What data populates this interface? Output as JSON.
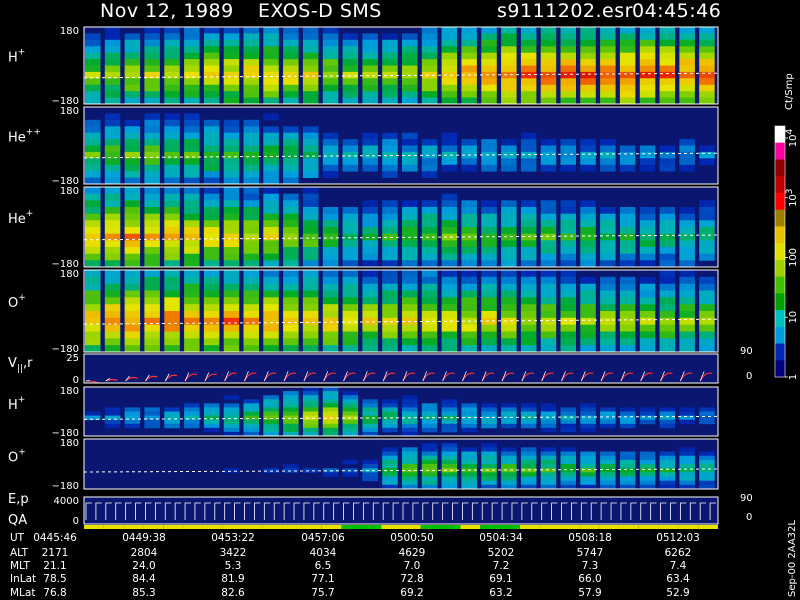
{
  "header": {
    "date": "Nov 12, 1989",
    "instrument": "EXOS-D SMS",
    "file": "s9111202.esr",
    "time": "04:45:46"
  },
  "chart_data": {
    "type": "heatmap",
    "panels": [
      {
        "label": "H",
        "sup": "+",
        "ymax": "180",
        "ymin": "−180",
        "intensity": [
          0.62,
          0.64,
          0.66,
          0.67,
          0.69,
          0.7,
          0.72,
          0.74,
          0.75,
          0.76,
          0.74,
          0.72,
          0.66,
          0.62,
          0.6,
          0.62,
          0.66,
          0.7,
          0.78,
          0.82,
          0.84,
          0.86,
          0.86,
          0.87,
          0.87,
          0.88,
          0.88,
          0.88,
          0.87,
          0.87,
          0.86,
          0.86
        ]
      },
      {
        "label": "He",
        "sup": "++",
        "ymax": "180",
        "ymin": "−180",
        "intensity": [
          0.55,
          0.58,
          0.58,
          0.57,
          0.56,
          0.55,
          0.55,
          0.54,
          0.53,
          0.52,
          0.5,
          0.45,
          0.4,
          0.38,
          0.36,
          0.36,
          0.35,
          0.35,
          0.34,
          0.33,
          0.33,
          0.32,
          0.32,
          0.31,
          0.3,
          0.3,
          0.3,
          0.29,
          0.28,
          0.28,
          0.27,
          0.26
        ]
      },
      {
        "label": "He",
        "sup": "+",
        "ymax": "180",
        "ymin": "−180",
        "intensity": [
          0.78,
          0.8,
          0.8,
          0.78,
          0.77,
          0.76,
          0.74,
          0.72,
          0.7,
          0.68,
          0.66,
          0.6,
          0.52,
          0.48,
          0.46,
          0.5,
          0.56,
          0.58,
          0.57,
          0.56,
          0.55,
          0.55,
          0.54,
          0.53,
          0.52,
          0.51,
          0.5,
          0.5,
          0.49,
          0.48,
          0.47,
          0.46
        ]
      },
      {
        "label": "O",
        "sup": "+",
        "ymax": "180",
        "ymin": "−180",
        "intensity": [
          0.8,
          0.82,
          0.84,
          0.84,
          0.84,
          0.83,
          0.82,
          0.82,
          0.81,
          0.8,
          0.78,
          0.76,
          0.74,
          0.72,
          0.7,
          0.7,
          0.72,
          0.72,
          0.7,
          0.7,
          0.69,
          0.68,
          0.67,
          0.66,
          0.65,
          0.64,
          0.64,
          0.63,
          0.62,
          0.62,
          0.61,
          0.6
        ]
      },
      {
        "label": "V",
        "sub": "||",
        "label2": ",r",
        "ymax": "25",
        "ymin": "0",
        "ymax_r": "90",
        "ymin_r": "0",
        "values": [
          2,
          4,
          6,
          7,
          8,
          9,
          9,
          10,
          10,
          10,
          10,
          10,
          10,
          10,
          10,
          10,
          10,
          10,
          10,
          10,
          10,
          10,
          10,
          10,
          10,
          10,
          10,
          10,
          10,
          10,
          10,
          10
        ]
      },
      {
        "label": "H",
        "sup": "+",
        "ymax": "180",
        "ymin": "−180",
        "intensity": [
          0.22,
          0.26,
          0.3,
          0.32,
          0.34,
          0.36,
          0.4,
          0.46,
          0.52,
          0.58,
          0.64,
          0.7,
          0.72,
          0.6,
          0.5,
          0.46,
          0.44,
          0.42,
          0.4,
          0.38,
          0.37,
          0.36,
          0.35,
          0.34,
          0.33,
          0.32,
          0.31,
          0.3,
          0.29,
          0.28,
          0.27,
          0.26
        ]
      },
      {
        "label": "O",
        "sup": "+",
        "ymax": "180",
        "ymin": "−180",
        "intensity": [
          0.05,
          0.05,
          0.05,
          0.05,
          0.05,
          0.05,
          0.06,
          0.08,
          0.1,
          0.12,
          0.14,
          0.16,
          0.18,
          0.22,
          0.3,
          0.5,
          0.56,
          0.58,
          0.57,
          0.56,
          0.55,
          0.54,
          0.53,
          0.52,
          0.51,
          0.5,
          0.49,
          0.48,
          0.47,
          0.46,
          0.45,
          0.44
        ]
      },
      {
        "label": "E,p",
        "label2": "QA",
        "ymax": "4000",
        "ymin": "0",
        "ymax_r": "90",
        "ymin_r": "0"
      }
    ],
    "colorbar": {
      "title": "Ct/Smp",
      "ticks": [
        {
          "label": "10",
          "sup": "4",
          "value": 4
        },
        {
          "label": "10",
          "sup": "3",
          "value": 3
        },
        {
          "label": "100",
          "value": 2
        },
        {
          "label": "10",
          "value": 1
        },
        {
          "label": "1",
          "value": 0
        }
      ],
      "colors": [
        "#000080",
        "#0028b4",
        "#009cdc",
        "#00c0c0",
        "#00a000",
        "#40c000",
        "#a0d000",
        "#e0e000",
        "#e8c000",
        "#a08000",
        "#ff0000",
        "#c00000",
        "#900000",
        "#ff00a0",
        "#ffffff"
      ]
    },
    "qa_bar": [
      "yellow",
      "yellow",
      "yellow",
      "yellow",
      "yellow",
      "yellow",
      "yellow",
      "yellow",
      "yellow",
      "yellow",
      "yellow",
      "yellow",
      "yellow",
      "green",
      "green",
      "yellow",
      "yellow",
      "green",
      "green",
      "yellow",
      "green",
      "green",
      "yellow",
      "yellow",
      "yellow",
      "yellow",
      "yellow",
      "yellow",
      "yellow",
      "yellow",
      "yellow",
      "yellow"
    ],
    "ephemeris": {
      "labels": [
        "UT",
        "ALT",
        "MLT",
        "InLat",
        "MLat"
      ],
      "columns": [
        [
          "0445:46",
          "2171",
          "21.1",
          "78.5",
          "76.8"
        ],
        [
          "0449:38",
          "2804",
          "24.0",
          "84.4",
          "85.3"
        ],
        [
          "0453:22",
          "3422",
          "5.3",
          "81.9",
          "82.6"
        ],
        [
          "0457:06",
          "4034",
          "6.5",
          "77.1",
          "75.7"
        ],
        [
          "0500:50",
          "4629",
          "7.0",
          "72.8",
          "69.2"
        ],
        [
          "0504:34",
          "5202",
          "7.2",
          "69.1",
          "63.2"
        ],
        [
          "0508:18",
          "5747",
          "7.3",
          "66.0",
          "57.9"
        ],
        [
          "0512:03",
          "6262",
          "7.4",
          "63.4",
          "52.9"
        ]
      ]
    },
    "footer": "Sep-00 2AA32L"
  }
}
